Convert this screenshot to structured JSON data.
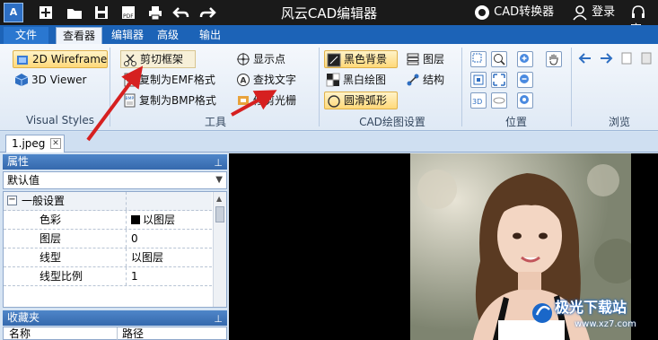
{
  "window": {
    "title": "风云CAD编辑器",
    "converter_label": "CAD转换器",
    "login_label": "登录",
    "service_label": "客"
  },
  "tabs": [
    {
      "label": "文件"
    },
    {
      "label": "查看器"
    },
    {
      "label": "编辑器"
    },
    {
      "label": "高级"
    },
    {
      "label": "输出"
    }
  ],
  "ribbon": {
    "visual_styles": {
      "wireframe": "2D Wireframe",
      "viewer3d": "3D Viewer",
      "group_label": "Visual Styles"
    },
    "tools": {
      "clip_frame": "剪切框架",
      "copy_emf": "复制为EMF格式",
      "copy_bmp": "复制为BMP格式",
      "show_points": "显示点",
      "find_text": "查找文字",
      "trim_raster": "修剪光栅",
      "group_label": "工具"
    },
    "cad_settings": {
      "black_bg": "黑色背景",
      "bw_draw": "黑白绘图",
      "smooth_arc": "圆滑弧形",
      "layers": "图层",
      "structure": "结构",
      "group_label": "CAD绘图设置"
    },
    "position": {
      "group_label": "位置"
    },
    "browse": {
      "group_label": "浏览"
    }
  },
  "document": {
    "tab_label": "1.jpeg"
  },
  "properties": {
    "header": "属性",
    "default_value": "默认值",
    "rows": [
      {
        "key": "一般设置",
        "value": ""
      },
      {
        "key": "色彩",
        "value": "以图层"
      },
      {
        "key": "图层",
        "value": "0"
      },
      {
        "key": "线型",
        "value": "以图层"
      },
      {
        "key": "线型比例",
        "value": "1"
      }
    ]
  },
  "favorites": {
    "header": "收藏夹",
    "col_name": "名称",
    "col_path": "路径"
  },
  "watermark": {
    "text": "极光下载站",
    "url": "www.xz7.com"
  },
  "colors": {
    "titlebar": "#1a1a1a",
    "tabrow": "#1c63b7",
    "panel_header": "#3569ad",
    "highlight": "#ffd97a",
    "annotation_arrow": "#d62020"
  }
}
